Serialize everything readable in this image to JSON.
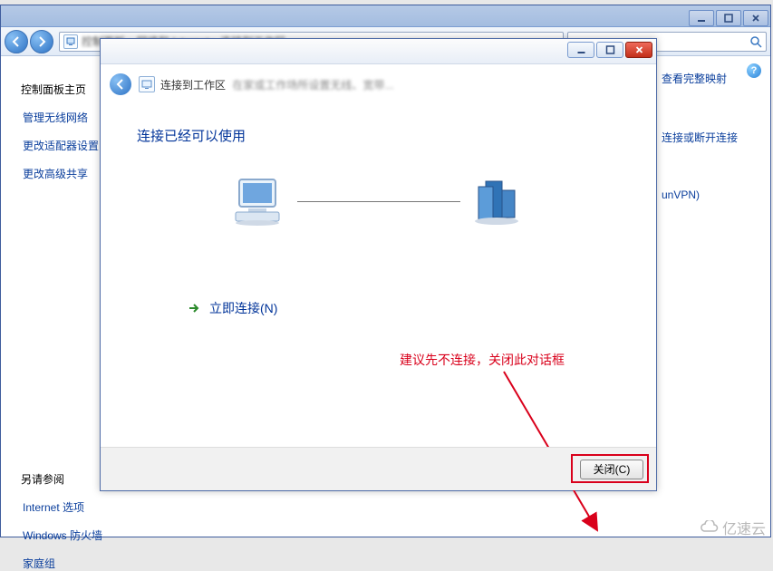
{
  "outer": {
    "addr_blur": "控制面板 ▸ 网络和 Internet ▸ 连接到工作区",
    "sidebar": {
      "heading": "控制面板主页",
      "items": [
        "管理无线网络",
        "更改适配器设置",
        "更改高级共享"
      ],
      "see_also_heading": "另请参阅",
      "see_also": [
        "Internet 选项",
        "Windows 防火墙",
        "家庭组"
      ]
    },
    "right_links": [
      "查看完整映射",
      "连接或断开连接",
      "unVPN)"
    ]
  },
  "dialog": {
    "title": "连接到工作区",
    "heading": "连接已经可以使用",
    "connect_now": "立即连接(N)",
    "close_button": "关闭(C)"
  },
  "annotation": {
    "text": "建议先不连接，关闭此对话框"
  },
  "watermark": "亿速云"
}
